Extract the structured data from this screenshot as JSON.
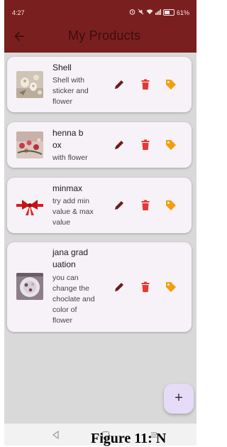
{
  "status_bar": {
    "time": "4:27",
    "battery_percent": "61%"
  },
  "app_bar": {
    "title": "My Products",
    "back_icon": "arrow-left-icon"
  },
  "products": [
    {
      "title": "Shell",
      "description": "Shell with sticker and flower",
      "image": "shell-product-image"
    },
    {
      "title": "henna box",
      "description": "with flower",
      "image": "henna-box-product-image"
    },
    {
      "title": "minmax",
      "description": "try add min value & max value",
      "image": "red-ribbon-product-image"
    },
    {
      "title": "jana grad uation",
      "description": "you can change the choclate and color of flower",
      "image": "graduation-plate-product-image"
    }
  ],
  "actions": {
    "edit_icon": "pencil-icon",
    "delete_icon": "trash-icon",
    "tag_icon": "tag-icon"
  },
  "fab": {
    "label": "+"
  },
  "nav_bar": {
    "icons": [
      "back-triangle-icon",
      "home-square-icon",
      "menu-lines-icon"
    ]
  },
  "caption": {
    "text": "Figure 11: N"
  },
  "colors": {
    "app_bar": "#7a1f1f",
    "title_text": "#3d0d0d",
    "edit": "#6b1d1d",
    "delete": "#e53935",
    "tag": "#f59e0b",
    "background": "#d9d9d9",
    "card": "#f7f2f7",
    "fab": "#e6dcf7"
  }
}
